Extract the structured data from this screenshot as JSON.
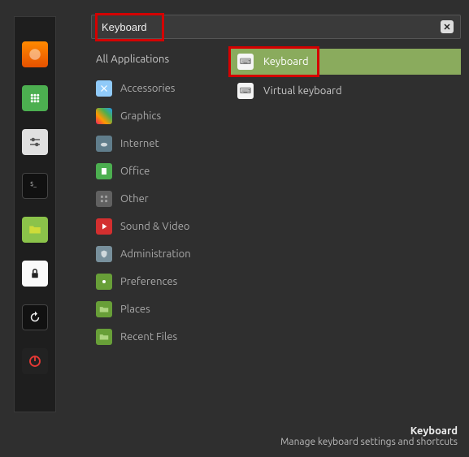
{
  "search": {
    "value": "Keyboard"
  },
  "categories": {
    "all": "All Applications",
    "items": [
      {
        "id": "accessories",
        "label": "Accessories"
      },
      {
        "id": "graphics",
        "label": "Graphics"
      },
      {
        "id": "internet",
        "label": "Internet"
      },
      {
        "id": "office",
        "label": "Office"
      },
      {
        "id": "other",
        "label": "Other"
      },
      {
        "id": "sound",
        "label": "Sound & Video"
      },
      {
        "id": "admin",
        "label": "Administration"
      },
      {
        "id": "prefs",
        "label": "Preferences"
      },
      {
        "id": "places",
        "label": "Places"
      },
      {
        "id": "recent",
        "label": "Recent Files"
      }
    ]
  },
  "results": [
    {
      "label": "Keyboard",
      "selected": true
    },
    {
      "label": "Virtual keyboard",
      "selected": false
    }
  ],
  "footer": {
    "title": "Keyboard",
    "description": "Manage keyboard settings and shortcuts"
  },
  "sidebar": [
    {
      "id": "firefox",
      "name": "firefox-launcher"
    },
    {
      "id": "apps",
      "name": "apps-launcher"
    },
    {
      "id": "settings",
      "name": "settings-launcher"
    },
    {
      "id": "terminal",
      "name": "terminal-launcher"
    },
    {
      "id": "files",
      "name": "files-launcher"
    },
    {
      "id": "lock",
      "name": "lock-launcher"
    },
    {
      "id": "reload",
      "name": "reload-launcher"
    },
    {
      "id": "power",
      "name": "power-launcher"
    }
  ]
}
